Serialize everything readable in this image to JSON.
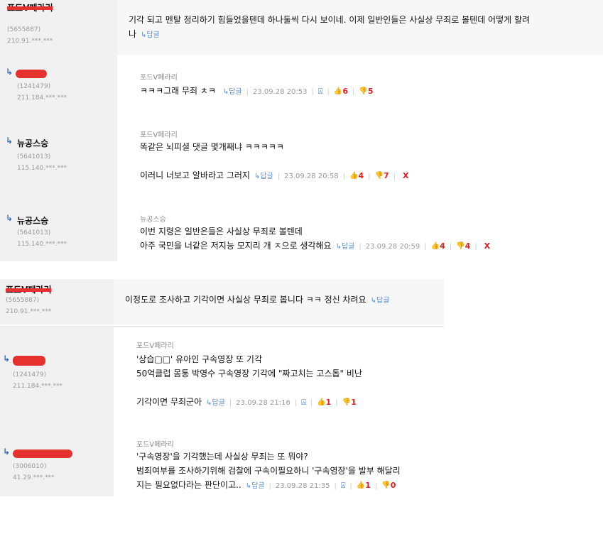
{
  "group1": {
    "main": {
      "nick": "포드V페라리",
      "user_id": "(5655887)",
      "ip": "210.91.***.***",
      "text_line1": "기각 되고 멘탈 정리하기 힘들었을텐데 하나둘씩 다시 보이네. 이제 일반인들은 사실상 무죄로 볼텐데 어떻게 할려",
      "text_line2": "나",
      "reply_label": "↳답글"
    },
    "replies": [
      {
        "nick_redacted": true,
        "user_id": "(1241479)",
        "ip": "211.184.***.***",
        "author": "포드V페라리",
        "lines": [
          "ㅋㅋㅋ그래 무죄 ㅊㅋ"
        ],
        "reply_label": "↳답글",
        "date": "23.09.28 20:53",
        "up": "6",
        "down": "5",
        "has_x": false
      },
      {
        "nick": "뉴공스승",
        "user_id": "(5641013)",
        "ip": "115.140.***.***",
        "author": "포드V페라리",
        "lines": [
          "똑같은 뇌피셜 댓글 몇개째냐 ㅋㅋㅋㅋㅋ",
          "",
          "이러니 너보고 알바라고 그러지"
        ],
        "reply_label": "↳답글",
        "date": "23.09.28 20:58",
        "up": "4",
        "down": "7",
        "has_x": true,
        "x_label": "X"
      },
      {
        "nick": "뉴공스승",
        "user_id": "(5641013)",
        "ip": "115.140.***.***",
        "author": "뉴공스승",
        "lines": [
          "이번 지령은 일반은들은 사실상 무죄로 볼텐데",
          "아주 국민을 너같은 저지능 모지리 개 ㅈ으로 생각해요"
        ],
        "reply_label": "↳답글",
        "date": "23.09.28 20:59",
        "up": "4",
        "down": "4",
        "has_x": true,
        "x_label": "X"
      }
    ]
  },
  "group2": {
    "main": {
      "nick": "포드V페라리",
      "user_id": "(5655887)",
      "ip": "210.91.***.***",
      "text": "이정도로 조사하고 기각이면 사실상 무죄로 봅니다 ㅋㅋ 정신 차려요",
      "reply_label": "↳답글"
    },
    "replies": [
      {
        "nick_redacted": true,
        "user_id": "(1241479)",
        "ip": "211.184.***.***",
        "author": "포드V페라리",
        "lines": [
          "'상습□□' 유아인 구속영장 또 기각",
          "50억클럽 몸통 박영수 구속영장 기각에 \"짜고치는 고스톱\" 비난",
          "",
          "기각이면 무죄군아"
        ],
        "reply_label": "↳답글",
        "date": "23.09.28 21:16",
        "up": "1",
        "down": "1",
        "has_x": false
      },
      {
        "nick_redacted": true,
        "user_id": "(3006010)",
        "ip": "41.29.***.***",
        "author": "포드V페라리",
        "lines": [
          "'구속영장'을 기각했는데 사실상 무죄는 또 뭐야?",
          "범죄여부를 조사하기위해 검찰에 구속이필요하니 '구속영장'을 발부 해달리",
          "지는 필요없다라는 판단이고.."
        ],
        "reply_label": "↳답글",
        "date": "23.09.28 21:35",
        "up": "1",
        "down": "0",
        "has_x": false
      }
    ]
  },
  "icons": {
    "reply_arrow": "reply-arrow-icon",
    "alert": "siren-icon",
    "thumb_up": "thumb-up-icon",
    "thumb_down": "thumb-down-icon"
  },
  "colors": {
    "vote_count": "#e02020",
    "link": "#5a8fd0",
    "icon_blue": "#2f6dc0",
    "redaction": "#e6322e"
  }
}
